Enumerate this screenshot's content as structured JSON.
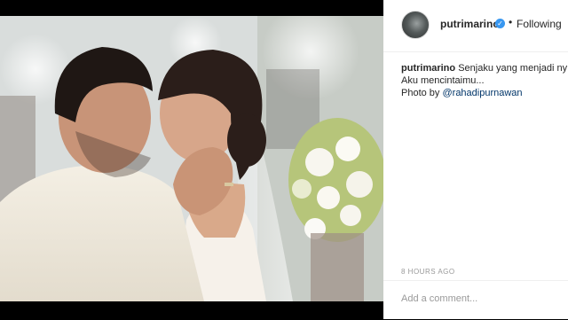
{
  "post": {
    "username": "putrimarino",
    "follow_status": "Following",
    "separator": "•",
    "verified_glyph": "✓",
    "caption_user": "putrimarino",
    "caption_line1": "Senjaku yang menjadi ny",
    "caption_line2": "Aku mencintaimu...",
    "photo_by_prefix": "Photo by ",
    "photo_by_mention": "@rahadipurnawan",
    "timestamp": "8 HOURS AGO"
  },
  "comment": {
    "placeholder": "Add a comment..."
  },
  "icons": {
    "verified": "verified-badge-icon",
    "avatar": "avatar-image"
  },
  "colors": {
    "verified": "#3897f0",
    "mention": "#003569",
    "muted": "#999999",
    "text": "#262626"
  }
}
